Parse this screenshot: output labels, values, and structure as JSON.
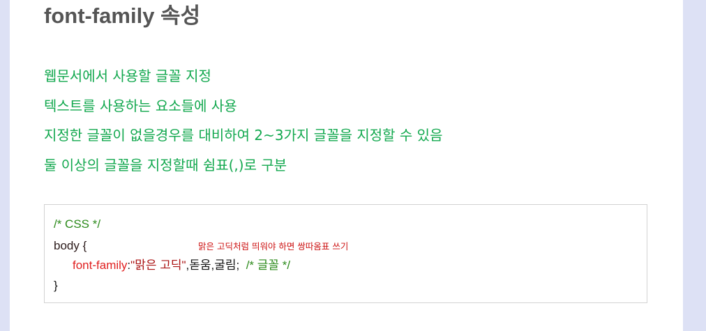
{
  "heading": "font-family 속성",
  "descriptions": [
    "웹문서에서 사용할 글꼴 지정",
    "텍스트를 사용하는 요소들에 사용",
    "지정한 글꼴이 없을경우를 대비하여 2~3가지 글꼴을 지정할 수 있음",
    "둘 이상의 글꼴을 지정할때 쉼표(,)로 구분"
  ],
  "code": {
    "comment": "/* CSS */",
    "selector": "body {",
    "property": "font-family",
    "colon": ":",
    "value_string": "\"맑은 고딕\"",
    "value_rest": ",돋움,굴림;",
    "inline_comment": "/* 글꼴 */",
    "close": "}",
    "annotation": "맑은 고딕처럼 띄워야 하면 쌍따옴표 쓰기"
  },
  "colors": {
    "page_background": "#dde1f5",
    "heading": "#555555",
    "description": "#12a84e",
    "comment": "#2b8a1a",
    "property": "#e02020",
    "annotation": "#cc1111"
  }
}
